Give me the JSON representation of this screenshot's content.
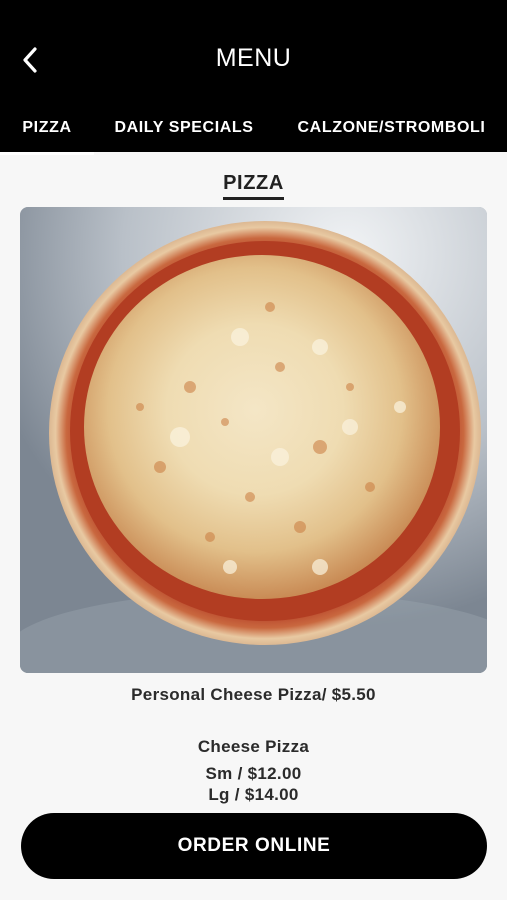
{
  "header": {
    "title": "MENU",
    "back_icon": "chevron-left-icon"
  },
  "tabs": [
    {
      "label": "PIZZA",
      "active": true
    },
    {
      "label": "DAILY SPECIALS",
      "active": false
    },
    {
      "label": "CALZONE/STROMBOLI",
      "active": false
    }
  ],
  "section": {
    "title": "PIZZA"
  },
  "items": {
    "personal": "Personal Cheese Pizza/ $5.50",
    "cheese_name": "Cheese Pizza",
    "cheese_small": "Sm / $12.00",
    "cheese_large": "Lg / $14.00"
  },
  "order_button": {
    "label": "ORDER ONLINE"
  },
  "colors": {
    "header_bg": "#000000",
    "page_bg": "#f7f7f7",
    "button_bg": "#000000"
  }
}
